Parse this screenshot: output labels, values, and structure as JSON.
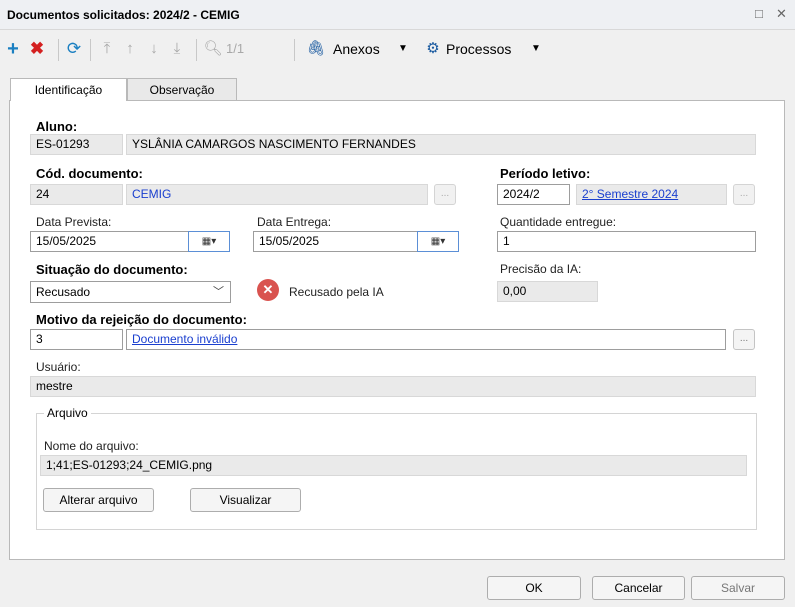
{
  "window": {
    "title": "Documentos solicitados: 2024/2 - CEMIG",
    "maximize_glyph": "□",
    "close_glyph": "✕"
  },
  "toolbar": {
    "add_icon": "plus-icon",
    "delete_icon": "x-icon",
    "refresh_icon": "refresh-icon",
    "record_position": "1/1",
    "attachments_label": "Anexos",
    "processes_label": "Processos",
    "colors": {
      "add": "#1a7fc1",
      "delete": "#d42020",
      "accent": "#1a5aa0"
    }
  },
  "tabs": [
    {
      "label": "Identificação",
      "active": true
    },
    {
      "label": "Observação",
      "active": false
    }
  ],
  "form": {
    "student": {
      "label": "Aluno:",
      "code": "ES-01293",
      "name": "YSLÂNIA CAMARGOS NASCIMENTO FERNANDES"
    },
    "document_code": {
      "label": "Cód. documento:",
      "code": "24",
      "name": "CEMIG"
    },
    "period": {
      "label": "Período letivo:",
      "code": "2024/2",
      "name": "2° Semestre 2024"
    },
    "expected_date": {
      "label": "Data Prevista:",
      "value": "15/05/2025"
    },
    "delivery_date": {
      "label": "Data Entrega:",
      "value": "15/05/2025"
    },
    "quantity": {
      "label": "Quantidade entregue:",
      "value": "1"
    },
    "status": {
      "label": "Situação do documento:",
      "value": "Recusado"
    },
    "ia_status": {
      "text": "Recusado pela IA",
      "icon": "error-icon",
      "color": "#d9534f"
    },
    "ia_precision": {
      "label": "Precisão da IA:",
      "value": "0,00"
    },
    "rejection_reason": {
      "label": "Motivo da rejeição do documento:",
      "code": "3",
      "description": "Documento inválido"
    },
    "user": {
      "label": "Usuário:",
      "value": "mestre"
    },
    "file": {
      "group_label": "Arquivo",
      "name_label": "Nome do arquivo:",
      "name_value": "1;41;ES-01293;24_CEMIG.png",
      "change_button": "Alterar arquivo",
      "view_button": "Visualizar"
    },
    "lookup_button": "..."
  },
  "footer": {
    "ok": "OK",
    "cancel": "Cancelar",
    "save": "Salvar"
  }
}
